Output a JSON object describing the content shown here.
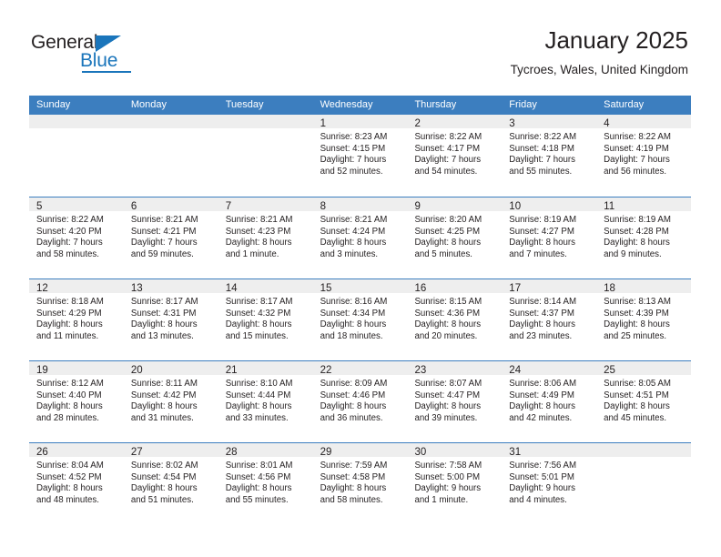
{
  "brand": {
    "name_part1": "General",
    "name_part2": "Blue",
    "accent_color": "#1a75bb"
  },
  "header": {
    "title": "January 2025",
    "subtitle": "Tycroes, Wales, United Kingdom"
  },
  "theme": {
    "header_row_bg": "#3c7ebf",
    "day_band_bg": "#eeeeee",
    "text_color": "#231f20"
  },
  "weekdays": [
    "Sunday",
    "Monday",
    "Tuesday",
    "Wednesday",
    "Thursday",
    "Friday",
    "Saturday"
  ],
  "weeks": [
    [
      {
        "day": "",
        "lines": []
      },
      {
        "day": "",
        "lines": []
      },
      {
        "day": "",
        "lines": []
      },
      {
        "day": "1",
        "lines": [
          "Sunrise: 8:23 AM",
          "Sunset: 4:15 PM",
          "Daylight: 7 hours",
          "and 52 minutes."
        ]
      },
      {
        "day": "2",
        "lines": [
          "Sunrise: 8:22 AM",
          "Sunset: 4:17 PM",
          "Daylight: 7 hours",
          "and 54 minutes."
        ]
      },
      {
        "day": "3",
        "lines": [
          "Sunrise: 8:22 AM",
          "Sunset: 4:18 PM",
          "Daylight: 7 hours",
          "and 55 minutes."
        ]
      },
      {
        "day": "4",
        "lines": [
          "Sunrise: 8:22 AM",
          "Sunset: 4:19 PM",
          "Daylight: 7 hours",
          "and 56 minutes."
        ]
      }
    ],
    [
      {
        "day": "5",
        "lines": [
          "Sunrise: 8:22 AM",
          "Sunset: 4:20 PM",
          "Daylight: 7 hours",
          "and 58 minutes."
        ]
      },
      {
        "day": "6",
        "lines": [
          "Sunrise: 8:21 AM",
          "Sunset: 4:21 PM",
          "Daylight: 7 hours",
          "and 59 minutes."
        ]
      },
      {
        "day": "7",
        "lines": [
          "Sunrise: 8:21 AM",
          "Sunset: 4:23 PM",
          "Daylight: 8 hours",
          "and 1 minute."
        ]
      },
      {
        "day": "8",
        "lines": [
          "Sunrise: 8:21 AM",
          "Sunset: 4:24 PM",
          "Daylight: 8 hours",
          "and 3 minutes."
        ]
      },
      {
        "day": "9",
        "lines": [
          "Sunrise: 8:20 AM",
          "Sunset: 4:25 PM",
          "Daylight: 8 hours",
          "and 5 minutes."
        ]
      },
      {
        "day": "10",
        "lines": [
          "Sunrise: 8:19 AM",
          "Sunset: 4:27 PM",
          "Daylight: 8 hours",
          "and 7 minutes."
        ]
      },
      {
        "day": "11",
        "lines": [
          "Sunrise: 8:19 AM",
          "Sunset: 4:28 PM",
          "Daylight: 8 hours",
          "and 9 minutes."
        ]
      }
    ],
    [
      {
        "day": "12",
        "lines": [
          "Sunrise: 8:18 AM",
          "Sunset: 4:29 PM",
          "Daylight: 8 hours",
          "and 11 minutes."
        ]
      },
      {
        "day": "13",
        "lines": [
          "Sunrise: 8:17 AM",
          "Sunset: 4:31 PM",
          "Daylight: 8 hours",
          "and 13 minutes."
        ]
      },
      {
        "day": "14",
        "lines": [
          "Sunrise: 8:17 AM",
          "Sunset: 4:32 PM",
          "Daylight: 8 hours",
          "and 15 minutes."
        ]
      },
      {
        "day": "15",
        "lines": [
          "Sunrise: 8:16 AM",
          "Sunset: 4:34 PM",
          "Daylight: 8 hours",
          "and 18 minutes."
        ]
      },
      {
        "day": "16",
        "lines": [
          "Sunrise: 8:15 AM",
          "Sunset: 4:36 PM",
          "Daylight: 8 hours",
          "and 20 minutes."
        ]
      },
      {
        "day": "17",
        "lines": [
          "Sunrise: 8:14 AM",
          "Sunset: 4:37 PM",
          "Daylight: 8 hours",
          "and 23 minutes."
        ]
      },
      {
        "day": "18",
        "lines": [
          "Sunrise: 8:13 AM",
          "Sunset: 4:39 PM",
          "Daylight: 8 hours",
          "and 25 minutes."
        ]
      }
    ],
    [
      {
        "day": "19",
        "lines": [
          "Sunrise: 8:12 AM",
          "Sunset: 4:40 PM",
          "Daylight: 8 hours",
          "and 28 minutes."
        ]
      },
      {
        "day": "20",
        "lines": [
          "Sunrise: 8:11 AM",
          "Sunset: 4:42 PM",
          "Daylight: 8 hours",
          "and 31 minutes."
        ]
      },
      {
        "day": "21",
        "lines": [
          "Sunrise: 8:10 AM",
          "Sunset: 4:44 PM",
          "Daylight: 8 hours",
          "and 33 minutes."
        ]
      },
      {
        "day": "22",
        "lines": [
          "Sunrise: 8:09 AM",
          "Sunset: 4:46 PM",
          "Daylight: 8 hours",
          "and 36 minutes."
        ]
      },
      {
        "day": "23",
        "lines": [
          "Sunrise: 8:07 AM",
          "Sunset: 4:47 PM",
          "Daylight: 8 hours",
          "and 39 minutes."
        ]
      },
      {
        "day": "24",
        "lines": [
          "Sunrise: 8:06 AM",
          "Sunset: 4:49 PM",
          "Daylight: 8 hours",
          "and 42 minutes."
        ]
      },
      {
        "day": "25",
        "lines": [
          "Sunrise: 8:05 AM",
          "Sunset: 4:51 PM",
          "Daylight: 8 hours",
          "and 45 minutes."
        ]
      }
    ],
    [
      {
        "day": "26",
        "lines": [
          "Sunrise: 8:04 AM",
          "Sunset: 4:52 PM",
          "Daylight: 8 hours",
          "and 48 minutes."
        ]
      },
      {
        "day": "27",
        "lines": [
          "Sunrise: 8:02 AM",
          "Sunset: 4:54 PM",
          "Daylight: 8 hours",
          "and 51 minutes."
        ]
      },
      {
        "day": "28",
        "lines": [
          "Sunrise: 8:01 AM",
          "Sunset: 4:56 PM",
          "Daylight: 8 hours",
          "and 55 minutes."
        ]
      },
      {
        "day": "29",
        "lines": [
          "Sunrise: 7:59 AM",
          "Sunset: 4:58 PM",
          "Daylight: 8 hours",
          "and 58 minutes."
        ]
      },
      {
        "day": "30",
        "lines": [
          "Sunrise: 7:58 AM",
          "Sunset: 5:00 PM",
          "Daylight: 9 hours",
          "and 1 minute."
        ]
      },
      {
        "day": "31",
        "lines": [
          "Sunrise: 7:56 AM",
          "Sunset: 5:01 PM",
          "Daylight: 9 hours",
          "and 4 minutes."
        ]
      },
      {
        "day": "",
        "lines": []
      }
    ]
  ]
}
